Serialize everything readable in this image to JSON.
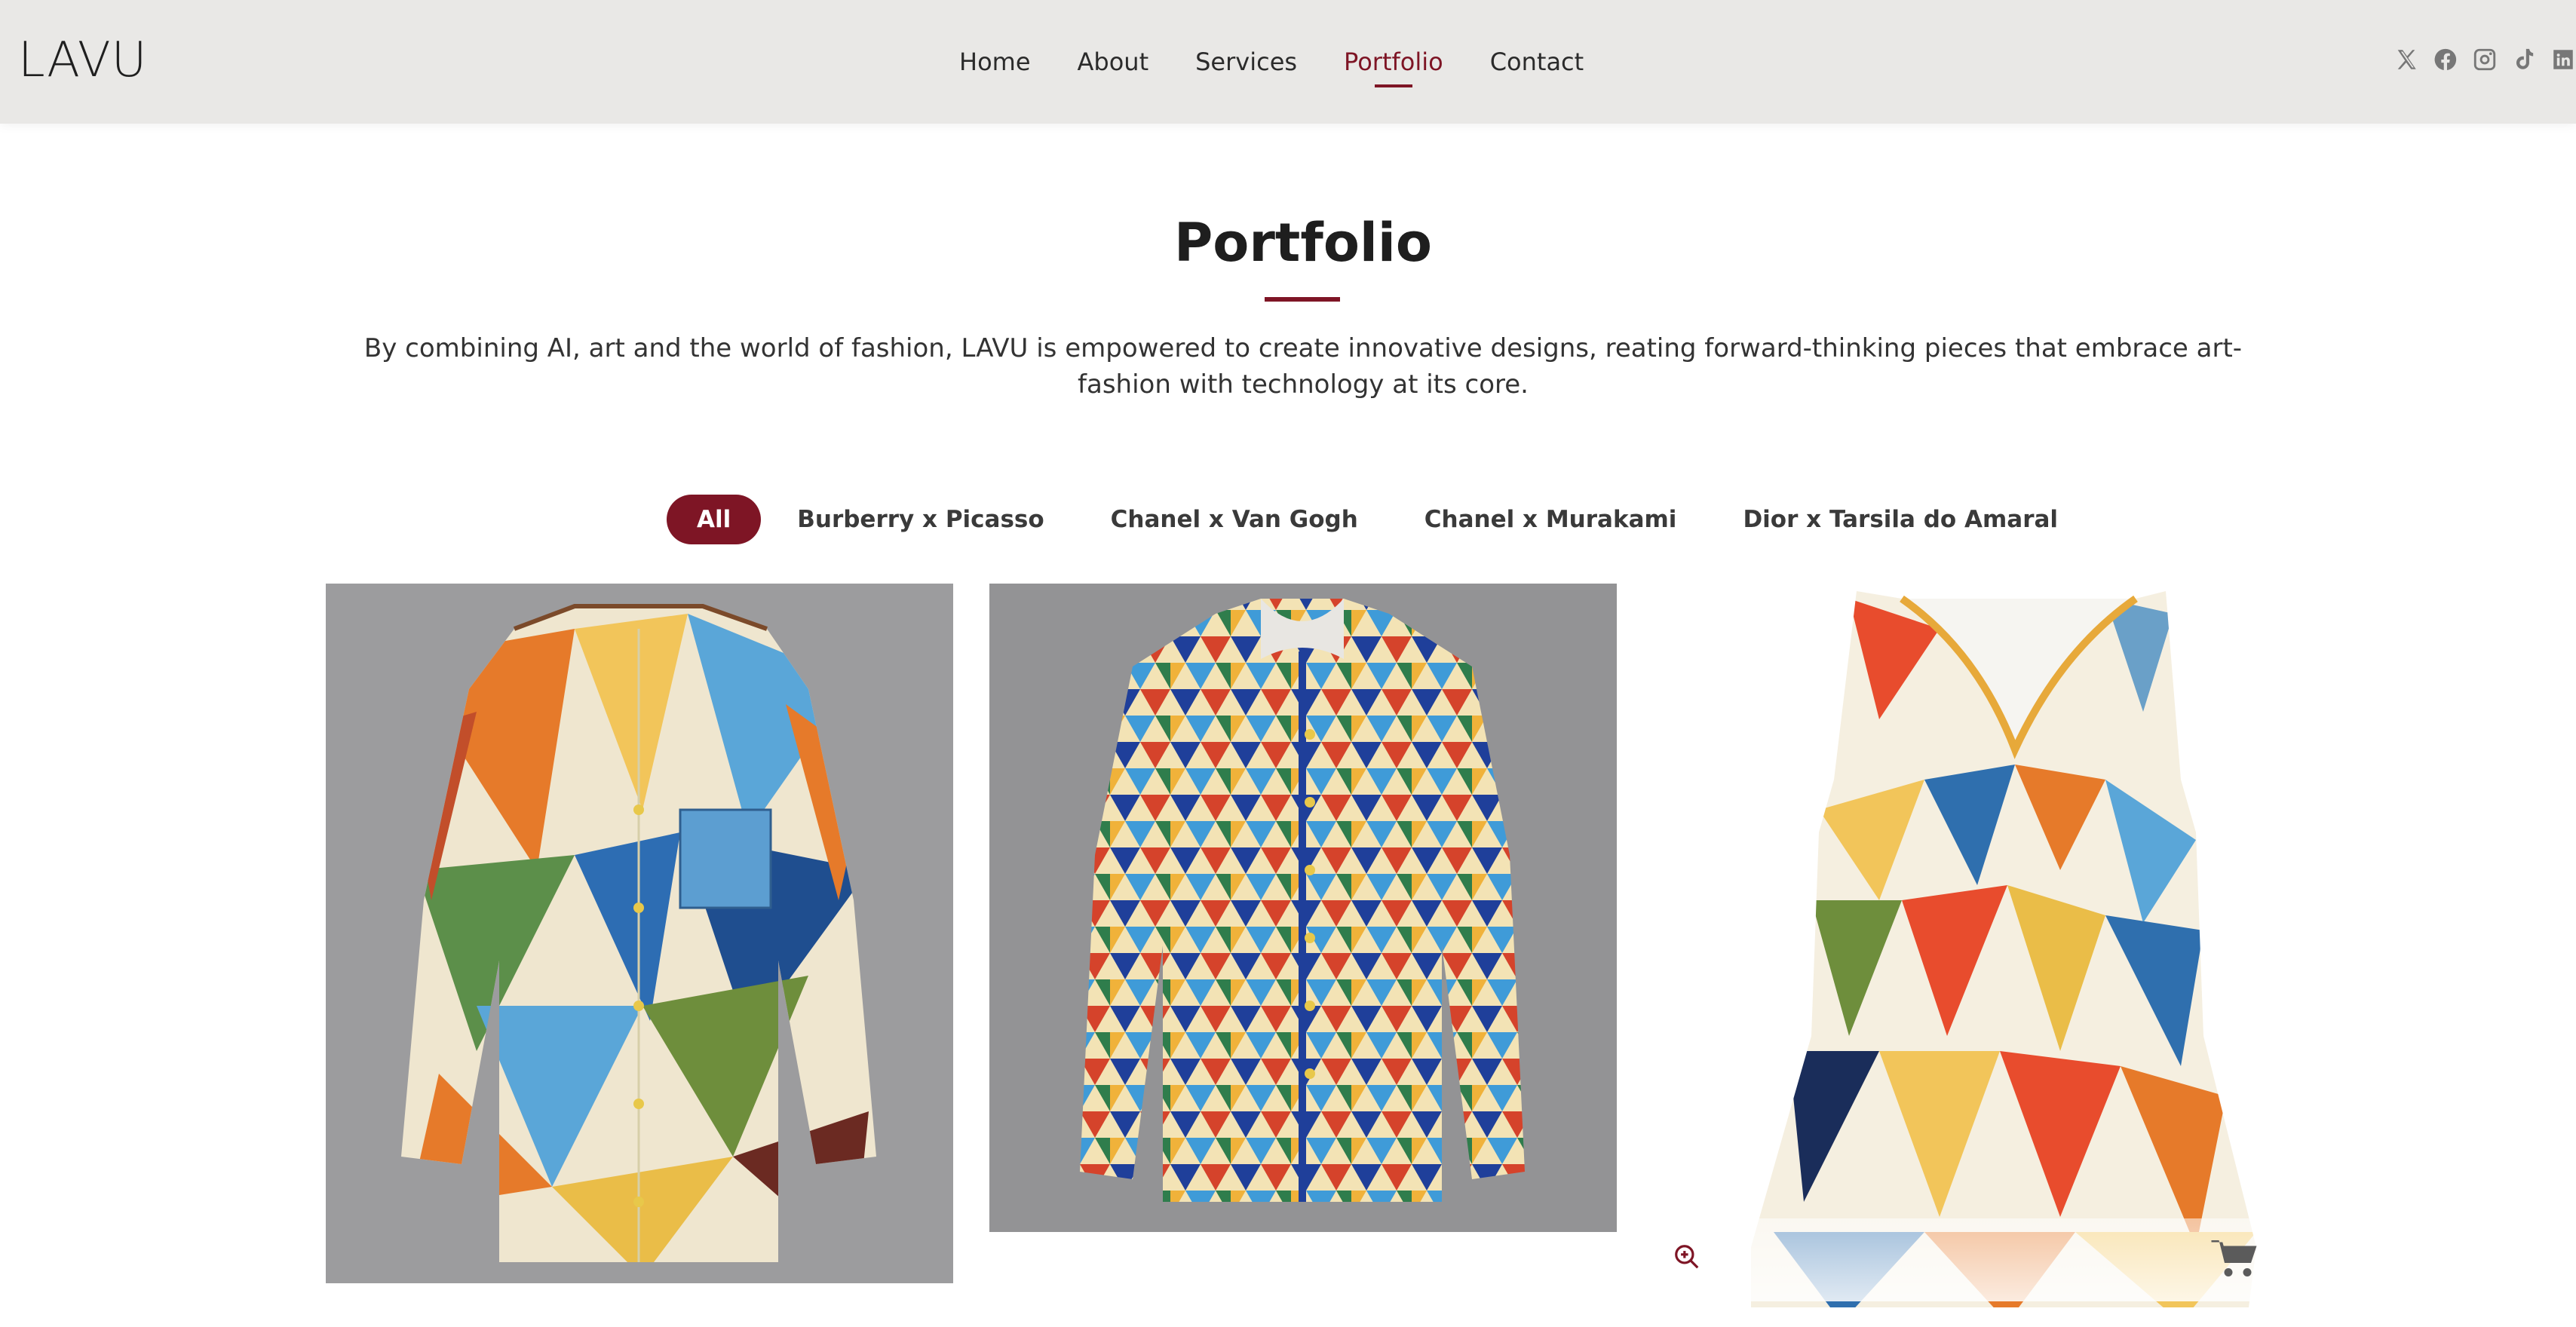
{
  "brand": {
    "logo_text": "LAVU"
  },
  "nav": {
    "items": [
      {
        "label": "Home",
        "active": false
      },
      {
        "label": "About",
        "active": false
      },
      {
        "label": "Services",
        "active": false
      },
      {
        "label": "Portfolio",
        "active": true
      },
      {
        "label": "Contact",
        "active": false
      }
    ]
  },
  "social": [
    "x-icon",
    "facebook-icon",
    "instagram-icon",
    "tiktok-icon",
    "linkedin-icon"
  ],
  "section": {
    "title": "Portfolio",
    "intro": "By combining AI, art and the world of fashion, LAVU is empowered to create innovative designs, reating forward-thinking pieces that embrace art-fashion with technology at its core."
  },
  "filters": [
    {
      "label": "All",
      "active": true
    },
    {
      "label": "Burberry x Picasso",
      "active": false
    },
    {
      "label": "Chanel x Van Gogh",
      "active": false
    },
    {
      "label": "Chanel x Murakami",
      "active": false
    },
    {
      "label": "Dior x Tarsila do Amaral",
      "active": false
    }
  ],
  "gallery": {
    "items": [
      "geometric-shirt-image",
      "triangle-shirt-image",
      "geometric-dress-image"
    ],
    "actions": [
      "zoom-icon",
      "cart-icon"
    ]
  },
  "colors": {
    "accent": "#7e1525",
    "header_bg": "#e9e8e6",
    "text": "#2b2b2b"
  }
}
